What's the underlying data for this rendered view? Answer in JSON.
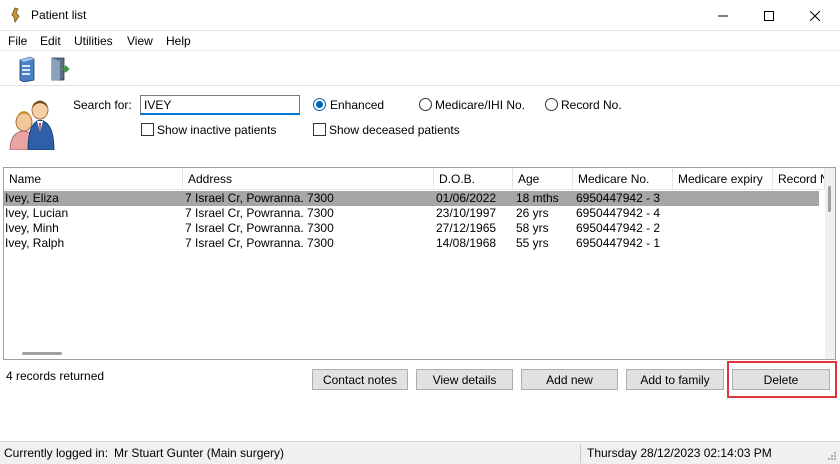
{
  "window": {
    "title": "Patient list",
    "minimize_glyph": "—",
    "maximize_glyph": "☐",
    "close_glyph": "✕"
  },
  "menu": [
    "File",
    "Edit",
    "Utilities",
    "View",
    "Help"
  ],
  "toolbar": {
    "icons": [
      "server-icon",
      "door-exit-icon"
    ]
  },
  "search": {
    "label": "Search for:",
    "value": "IVEY",
    "options": [
      {
        "label": "Enhanced",
        "selected": true
      },
      {
        "label": "Medicare/IHI No.",
        "selected": false
      },
      {
        "label": "Record No.",
        "selected": false
      }
    ],
    "show_inactive": "Show inactive patients",
    "show_deceased": "Show deceased patients"
  },
  "table": {
    "columns": [
      "Name",
      "Address",
      "D.O.B.",
      "Age",
      "Medicare No.",
      "Medicare expiry",
      "Record No."
    ],
    "rows": [
      {
        "name": "Ivey, Eliza",
        "address": "7 Israel Cr, Powranna. 7300",
        "dob": "01/06/2022",
        "age": "18 mths",
        "medicare": "6950447942 - 3",
        "selected": true
      },
      {
        "name": "Ivey, Lucian",
        "address": "7 Israel Cr, Powranna. 7300",
        "dob": "23/10/1997",
        "age": "26 yrs",
        "medicare": "6950447942 - 4",
        "selected": false
      },
      {
        "name": "Ivey, Minh",
        "address": "7 Israel Cr, Powranna. 7300",
        "dob": "27/12/1965",
        "age": "58 yrs",
        "medicare": "6950447942 - 2",
        "selected": false
      },
      {
        "name": "Ivey, Ralph",
        "address": "7 Israel Cr, Powranna. 7300",
        "dob": "14/08/1968",
        "age": "55 yrs",
        "medicare": "6950447942 - 1",
        "selected": false
      }
    ]
  },
  "records_returned": "4 records returned",
  "buttons": {
    "contact_notes": "Contact notes",
    "view_details": "View details",
    "add_new": "Add new",
    "add_to_family": "Add to family",
    "delete": "Delete"
  },
  "status": {
    "logged_in_label": "Currently logged in:",
    "user": "Mr Stuart Gunter (Main surgery)",
    "datetime": "Thursday 28/12/2023 02:14:03 PM"
  },
  "colors": {
    "selection": "#a6a6a6",
    "highlight_box": "#e0343b",
    "radio_accent": "#0063b1"
  }
}
